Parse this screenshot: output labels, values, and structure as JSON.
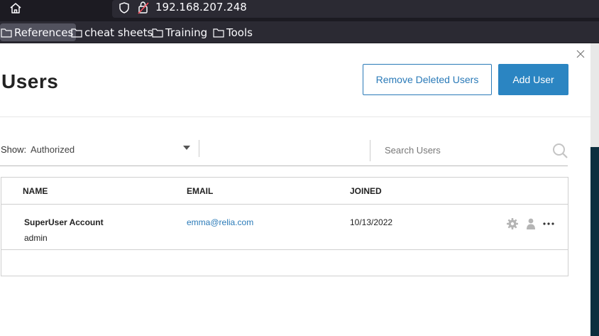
{
  "browser": {
    "url": "192.168.207.248",
    "bookmarks": [
      "References",
      "cheat sheets",
      "Training",
      "Tools"
    ]
  },
  "header": {
    "title": "Users",
    "remove_deleted_label": "Remove Deleted Users",
    "add_user_label": "Add User"
  },
  "filter": {
    "show_label": "Show:",
    "show_value": "Authorized",
    "search_placeholder": "Search Users"
  },
  "table": {
    "columns": [
      "NAME",
      "EMAIL",
      "JOINED"
    ],
    "rows": [
      {
        "name": "SuperUser Account",
        "role": "admin",
        "email": "emma@relia.com",
        "joined": "10/13/2022"
      }
    ]
  },
  "colors": {
    "accent": "#2b85c2",
    "link": "#2a7ab8"
  }
}
